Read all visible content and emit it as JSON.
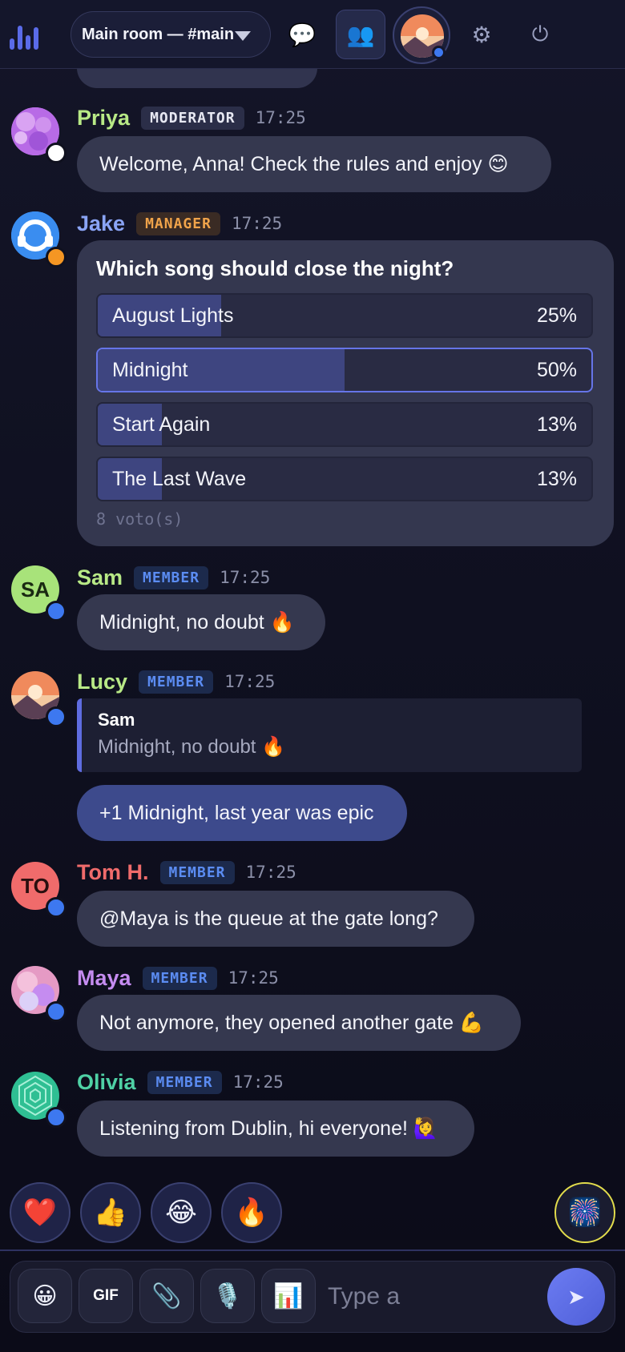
{
  "header": {
    "room_label": "Main room — #main",
    "icons": [
      "chat-icon",
      "users-icon",
      "settings-icon",
      "power-icon"
    ],
    "chat_glyph": "💬",
    "users_glyph": "👥",
    "settings_glyph": "⚙",
    "power_glyph": "⏻",
    "accent": "#5a6be8"
  },
  "messages": [
    {
      "name": "Priya",
      "badge": "MODERATOR",
      "time": "17:25",
      "text": "Welcome, Anna! Check the rules and enjoy 😊",
      "name_color": "#b8e986"
    },
    {
      "name": "Jake",
      "badge": "MANAGER",
      "time": "17:25",
      "name_color": "#8aa4f5"
    },
    {
      "name": "Sam",
      "badge": "MEMBER",
      "time": "17:25",
      "text": "Midnight, no doubt 🔥",
      "initials": "SA",
      "name_color": "#b8e986"
    },
    {
      "name": "Lucy",
      "badge": "MEMBER",
      "time": "17:25",
      "text": "+1 Midnight, last year was epic",
      "name_color": "#b8e986"
    },
    {
      "name": "Tom H.",
      "badge": "MEMBER",
      "time": "17:25",
      "text": "@Maya is the queue at the gate long?",
      "initials": "TO",
      "name_color": "#f06b6b"
    },
    {
      "name": "Maya",
      "badge": "MEMBER",
      "time": "17:25",
      "text": "Not anymore, they opened another gate 💪",
      "name_color": "#c58cf0"
    },
    {
      "name": "Olivia",
      "badge": "MEMBER",
      "time": "17:25",
      "text": "Listening from Dublin, hi everyone! 🙋‍♀️",
      "name_color": "#4fd1a5"
    }
  ],
  "poll": {
    "question": "Which song should close the night?",
    "options": [
      {
        "label": "August Lights",
        "pct_text": "25%",
        "share": 0.25
      },
      {
        "label": "Midnight",
        "pct_text": "50%",
        "share": 0.5,
        "selected": true
      },
      {
        "label": "Start Again",
        "pct_text": "13%",
        "share": 0.13
      },
      {
        "label": "The Last Wave",
        "pct_text": "13%",
        "share": 0.13
      }
    ],
    "votes_text": "8 voto(s)"
  },
  "quote": {
    "name": "Sam",
    "text": "Midnight, no doubt 🔥"
  },
  "reactions": [
    "❤️",
    "👍",
    "😂",
    "🔥"
  ],
  "fireworks": "🎆",
  "composer": {
    "tools": [
      "😀",
      "GIF",
      "📎",
      "🎙️",
      "📊"
    ],
    "placeholder": "Type a",
    "send_glyph": "➤"
  }
}
